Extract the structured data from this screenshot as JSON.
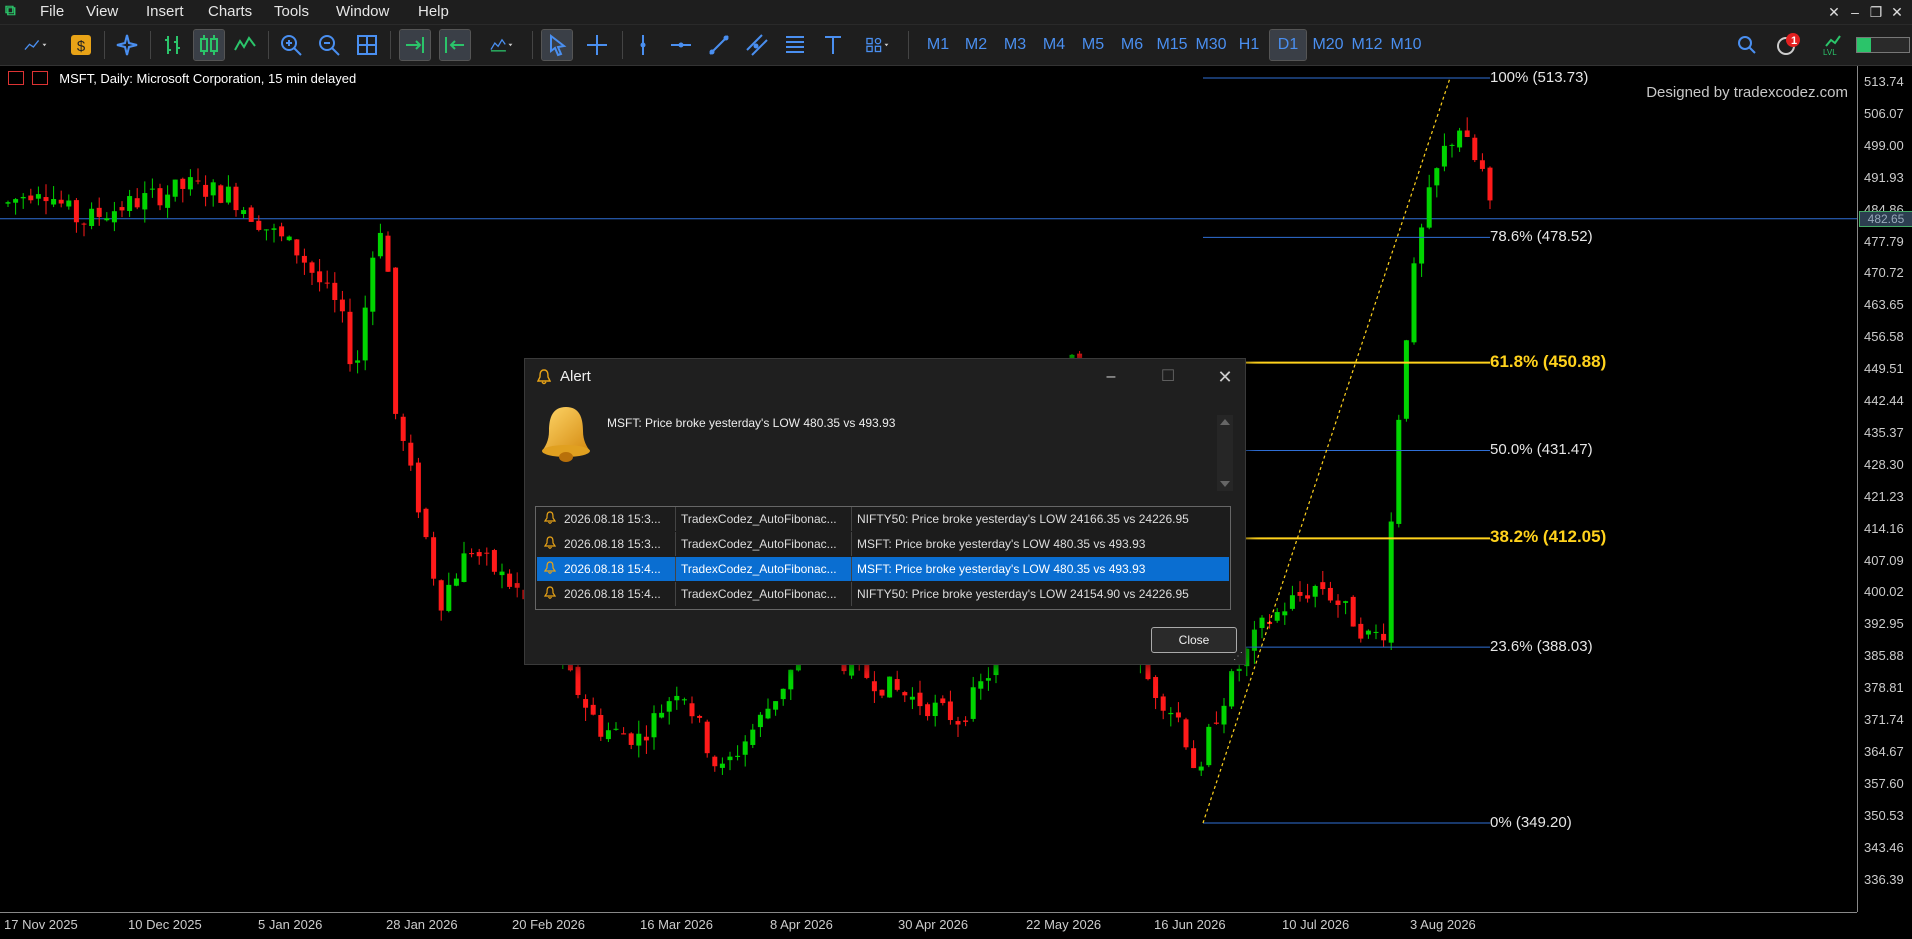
{
  "menubar": {
    "items": [
      "File",
      "View",
      "Insert",
      "Charts",
      "Tools",
      "Window",
      "Help"
    ]
  },
  "toolbar": {
    "timeframes": [
      "M1",
      "M2",
      "M3",
      "M4",
      "M5",
      "M6",
      "M15",
      "M30",
      "H1",
      "D1",
      "M20",
      "M12",
      "M10"
    ],
    "active_timeframe": "D1",
    "notification_count": "1",
    "lvl_label": "LVL"
  },
  "chart": {
    "symbol_info": "MSFT, Daily:  Microsoft Corporation, 15 min delayed",
    "watermark": "Designed by tradexcodez.com",
    "current_price_label": "482.65",
    "price_ticks": [
      "513.74",
      "506.07",
      "499.00",
      "491.93",
      "484.86",
      "477.79",
      "470.72",
      "463.65",
      "456.58",
      "449.51",
      "442.44",
      "435.37",
      "428.30",
      "421.23",
      "414.16",
      "407.09",
      "400.02",
      "392.95",
      "385.88",
      "378.81",
      "371.74",
      "364.67",
      "357.60",
      "350.53",
      "343.46",
      "336.39"
    ],
    "date_ticks": [
      "17 Nov 2025",
      "10 Dec 2025",
      "5 Jan 2026",
      "28 Jan 2026",
      "20 Feb 2026",
      "16 Mar 2026",
      "8 Apr 2026",
      "30 Apr 2026",
      "22 May 2026",
      "16 Jun 2026",
      "10 Jul 2026",
      "3 Aug 2026"
    ],
    "fib_levels": [
      {
        "label": "100% (513.73)",
        "price": 513.73,
        "style": "blue"
      },
      {
        "label": "78.6% (478.52)",
        "price": 478.52,
        "style": "blue"
      },
      {
        "label": "61.8% (450.88)",
        "price": 450.88,
        "style": "gold"
      },
      {
        "label": "50.0% (431.47)",
        "price": 431.47,
        "style": "blue"
      },
      {
        "label": "38.2% (412.05)",
        "price": 412.05,
        "style": "gold"
      },
      {
        "label": "23.6% (388.03)",
        "price": 388.03,
        "style": "blue"
      },
      {
        "label": "0% (349.20)",
        "price": 349.2,
        "style": "blue"
      }
    ],
    "colors": {
      "up": "#00d400",
      "down": "#ff1a1a",
      "fib_blue": "#2f6fd6",
      "fib_gold": "#ffd21c"
    }
  },
  "alert": {
    "title": "Alert",
    "message": "MSFT: Price broke yesterday's LOW 480.35 vs 493.93",
    "rows": [
      {
        "time": "2026.08.18 15:3...",
        "source": "TradexCodez_AutoFibonac...",
        "text": "NIFTY50: Price broke yesterday's LOW 24166.35 vs 24226.95",
        "selected": false
      },
      {
        "time": "2026.08.18 15:3...",
        "source": "TradexCodez_AutoFibonac...",
        "text": "MSFT: Price broke yesterday's LOW 480.35 vs 493.93",
        "selected": false
      },
      {
        "time": "2026.08.18 15:4...",
        "source": "TradexCodez_AutoFibonac...",
        "text": "MSFT: Price broke yesterday's LOW 480.35 vs 493.93",
        "selected": true
      },
      {
        "time": "2026.08.18 15:4...",
        "source": "TradexCodez_AutoFibonac...",
        "text": "NIFTY50: Price broke yesterday's LOW 24154.90 vs 24226.95",
        "selected": false
      }
    ],
    "close_label": "Close"
  }
}
